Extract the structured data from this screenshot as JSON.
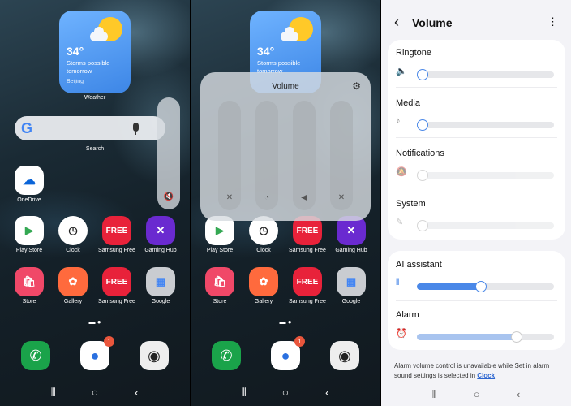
{
  "home": {
    "weather": {
      "temp": "34°",
      "desc": "Storms possible tomorrow",
      "city": "Beijing",
      "label": "Weather"
    },
    "search_label": "Search",
    "onedrive_label": "OneDrive",
    "apps_row1": [
      "Play Store",
      "Clock",
      "Samsung Free",
      "Gaming Hub"
    ],
    "apps_row2": [
      "Store",
      "Gallery",
      "Samsung Free",
      "Google"
    ],
    "volume_menu": "⋯",
    "messages_badge": "1"
  },
  "volume_popup": {
    "title": "Volume"
  },
  "settings": {
    "title": "Volume",
    "sliders": [
      {
        "label": "Ringtone",
        "level": 0
      },
      {
        "label": "Media",
        "level": 0
      },
      {
        "label": "Notifications",
        "level": 0
      },
      {
        "label": "System",
        "level": 0
      }
    ],
    "ai_assistant": {
      "label": "AI assistant",
      "level": 0.47
    },
    "alarm": {
      "label": "Alarm",
      "level": 0.73
    },
    "note": "Alarm volume control is unavailable while Set in alarm sound settings is selected in",
    "note_link": "Clock"
  },
  "colors": {
    "accent": "#4a88e8",
    "badge": "#e9563c"
  }
}
